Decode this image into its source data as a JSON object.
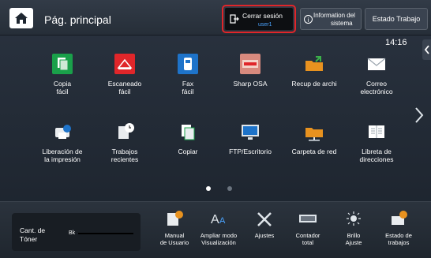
{
  "header": {
    "home_title": "Pág. principal",
    "logout_label": "Cerrar sesión",
    "user": "user1",
    "info_line1": "Information del",
    "info_line2": "sistema",
    "status_label": "Estado Trabajo",
    "time": "14:16"
  },
  "tiles": [
    {
      "label_1": "Copia",
      "label_2": "fácil",
      "icon": "copy-icon"
    },
    {
      "label_1": "Escaneado",
      "label_2": "fácil",
      "icon": "scan-icon"
    },
    {
      "label_1": "Fax",
      "label_2": "fácil",
      "icon": "fax-icon"
    },
    {
      "label_1": "Sharp OSA",
      "label_2": "",
      "icon": "osa-icon"
    },
    {
      "label_1": "Recup de archi",
      "label_2": "",
      "icon": "folder-retrieve-icon"
    },
    {
      "label_1": "Correo",
      "label_2": "electrónico",
      "icon": "mail-icon"
    },
    {
      "label_1": "Liberación de",
      "label_2": "la impresión",
      "icon": "print-release-icon"
    },
    {
      "label_1": "Trabajos",
      "label_2": "recientes",
      "icon": "recent-jobs-icon"
    },
    {
      "label_1": "Copiar",
      "label_2": "",
      "icon": "copier-icon"
    },
    {
      "label_1": "FTP/Escritorio",
      "label_2": "",
      "icon": "ftp-desktop-icon"
    },
    {
      "label_1": "Carpeta de red",
      "label_2": "",
      "icon": "network-folder-icon"
    },
    {
      "label_1": "Libreta de",
      "label_2": "direcciones",
      "icon": "address-book-icon"
    }
  ],
  "page_dots": {
    "count": 2,
    "active": 0
  },
  "toner": {
    "label_1": "Cant. de",
    "label_2": "Tóner",
    "color_label": "Bk",
    "level": 1.0
  },
  "bottom_items": [
    {
      "label_1": "Manual",
      "label_2": "de Usuario",
      "icon": "manual-icon"
    },
    {
      "label_1": "Ampliar modo",
      "label_2": "Visualización",
      "icon": "text-size-icon"
    },
    {
      "label_1": "Ajustes",
      "label_2": "",
      "icon": "tools-icon"
    },
    {
      "label_1": "Contador",
      "label_2": "total",
      "icon": "counter-icon"
    },
    {
      "label_1": "Brillo",
      "label_2": "Ajuste",
      "icon": "brightness-icon"
    },
    {
      "label_1": "Estado de",
      "label_2": "trabajos",
      "icon": "job-status-icon"
    }
  ],
  "colors": {
    "logout_outline": "#e0262a",
    "user_text": "#4aa3ff",
    "green_tile": "#1aa04a",
    "red_tile": "#e0262a",
    "blue_tile": "#1e73c9",
    "orange_tile": "#e8921f"
  }
}
